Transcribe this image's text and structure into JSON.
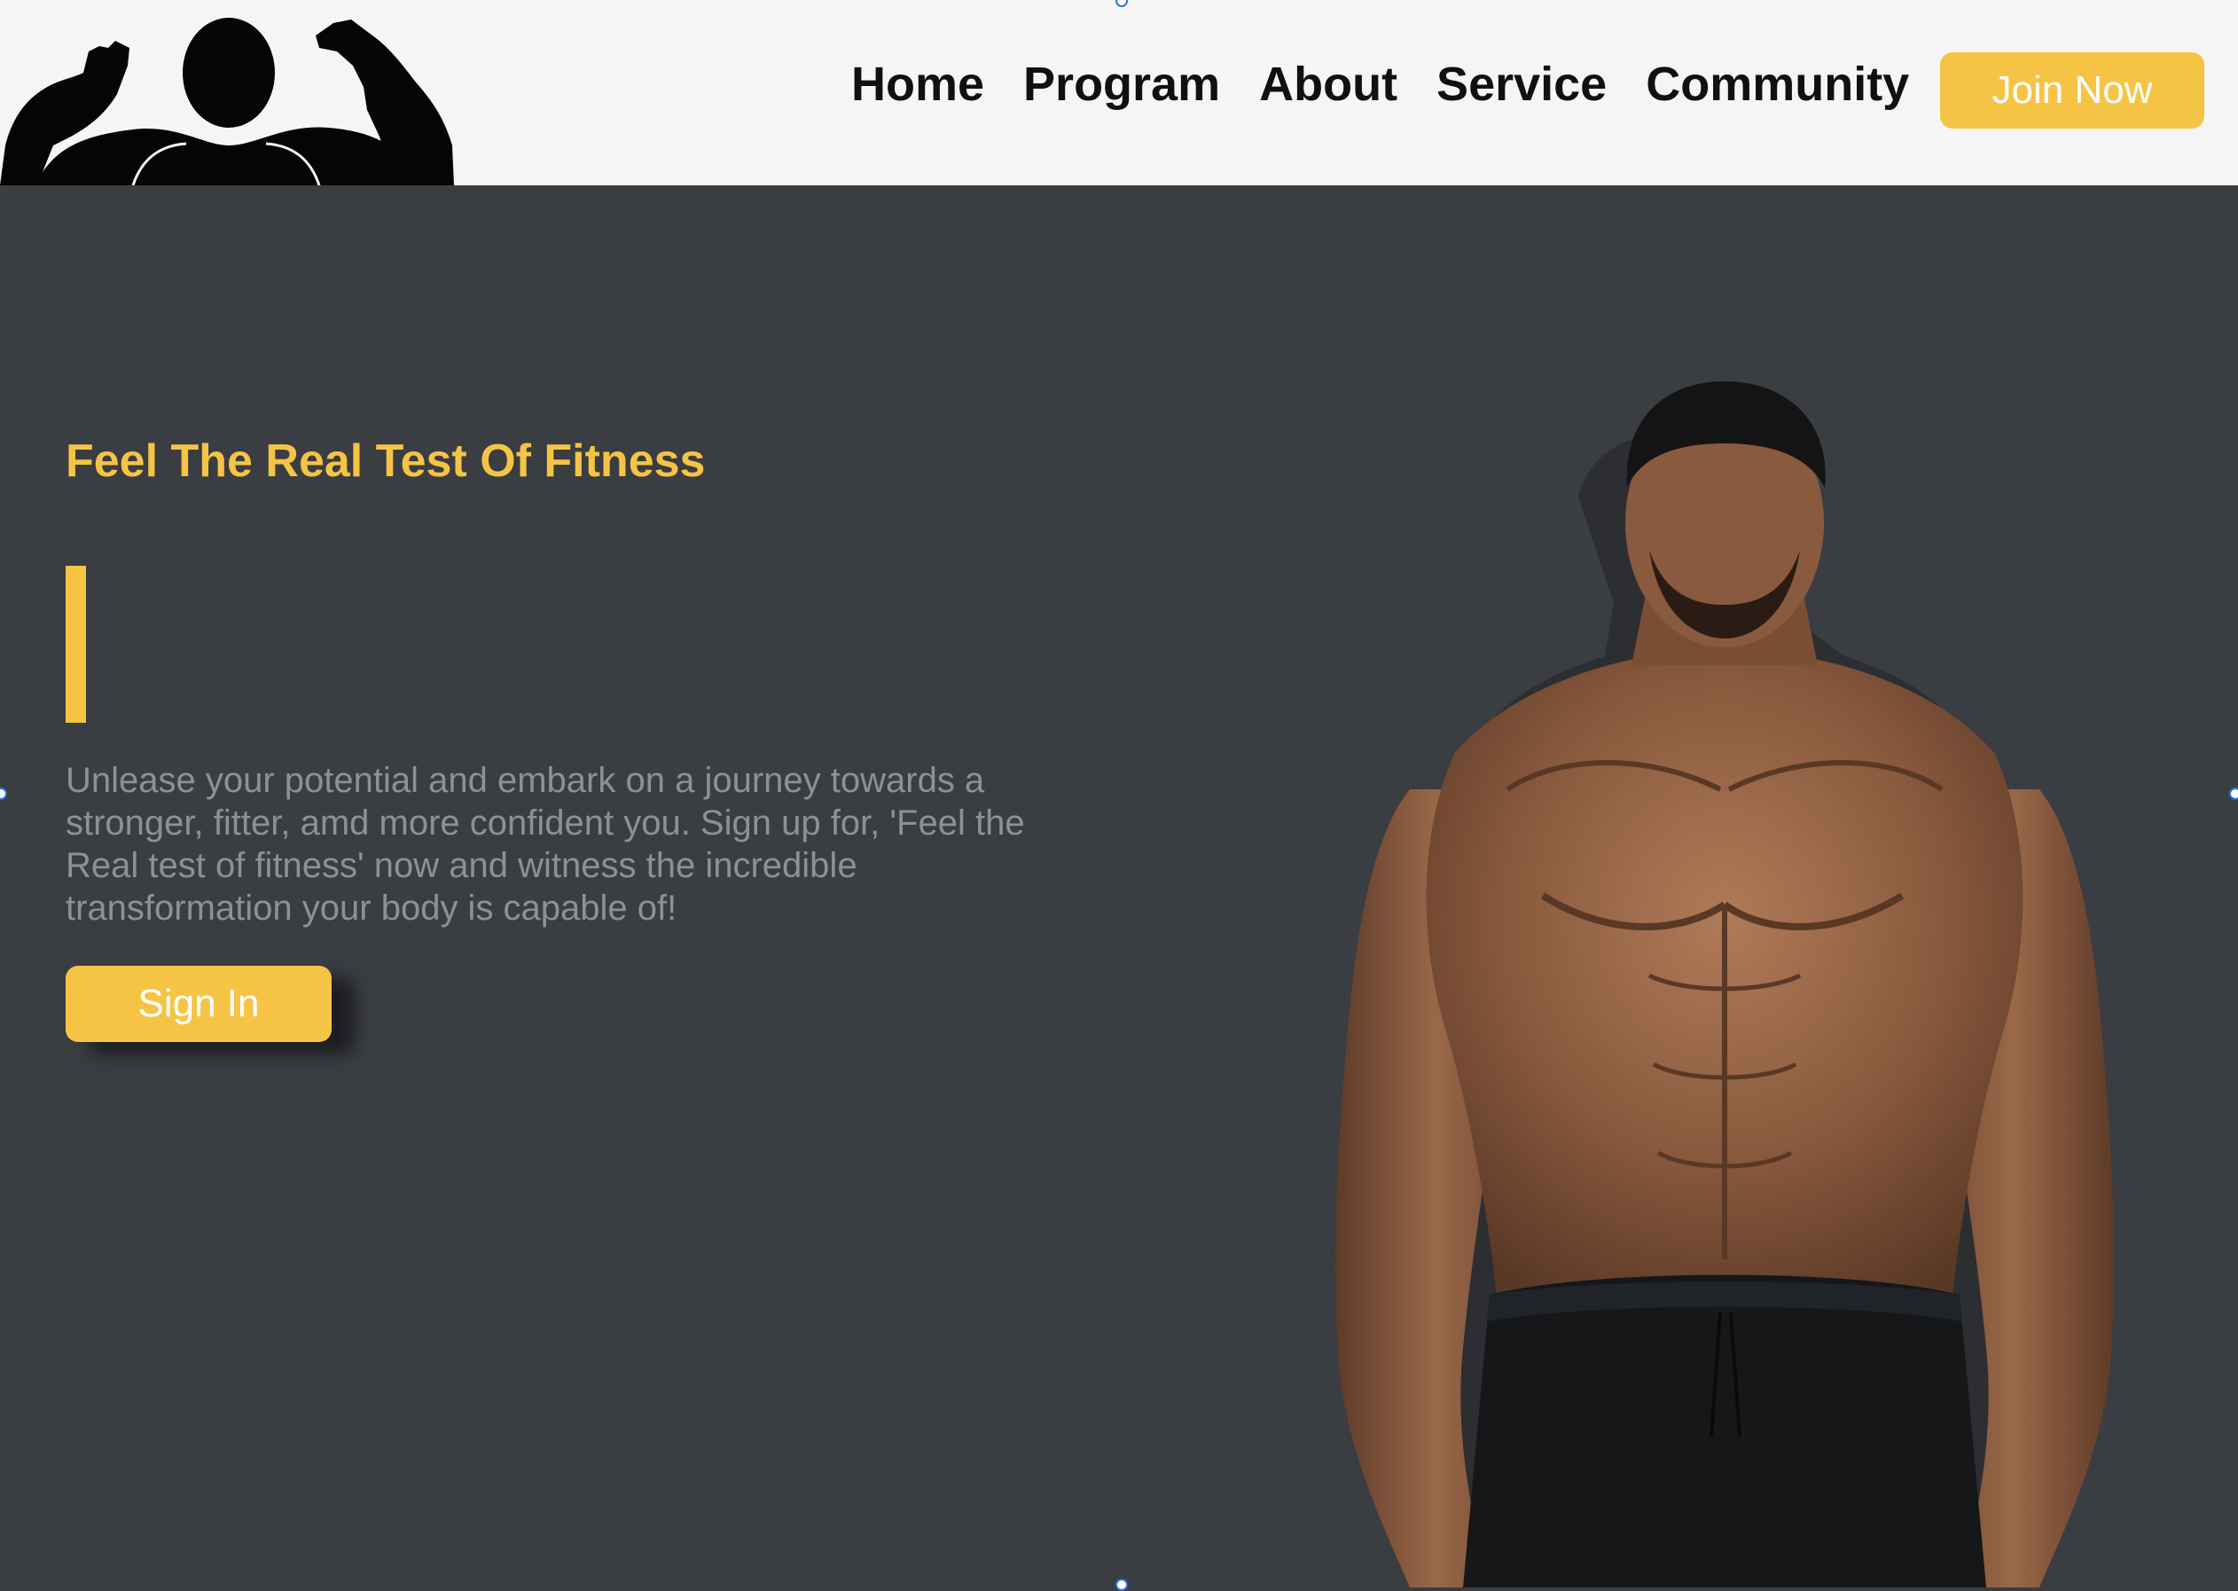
{
  "header": {
    "logo_icon": "flexing-bodybuilder-silhouette",
    "nav": [
      {
        "label": "Home"
      },
      {
        "label": "Program"
      },
      {
        "label": "About"
      },
      {
        "label": "Service"
      },
      {
        "label": "Community"
      }
    ],
    "join_label": "Join Now"
  },
  "hero": {
    "title": "Feel The Real Test Of Fitness",
    "description": "Unlease your potential and embark on a journey towards a stronger, fitter, amd more confident you. Sign up for, 'Feel the Real test of fitness' now and witness the incredible transformation your body is capable of!",
    "signin_label": "Sign In",
    "image_icon": "bodybuilder-photo"
  },
  "colors": {
    "accent": "#f6c445",
    "header_bg": "#f5f5f5",
    "page_bg": "#3a3d42",
    "nav_text": "#101010",
    "body_text": "#8e9096",
    "button_text": "#ffffff"
  }
}
